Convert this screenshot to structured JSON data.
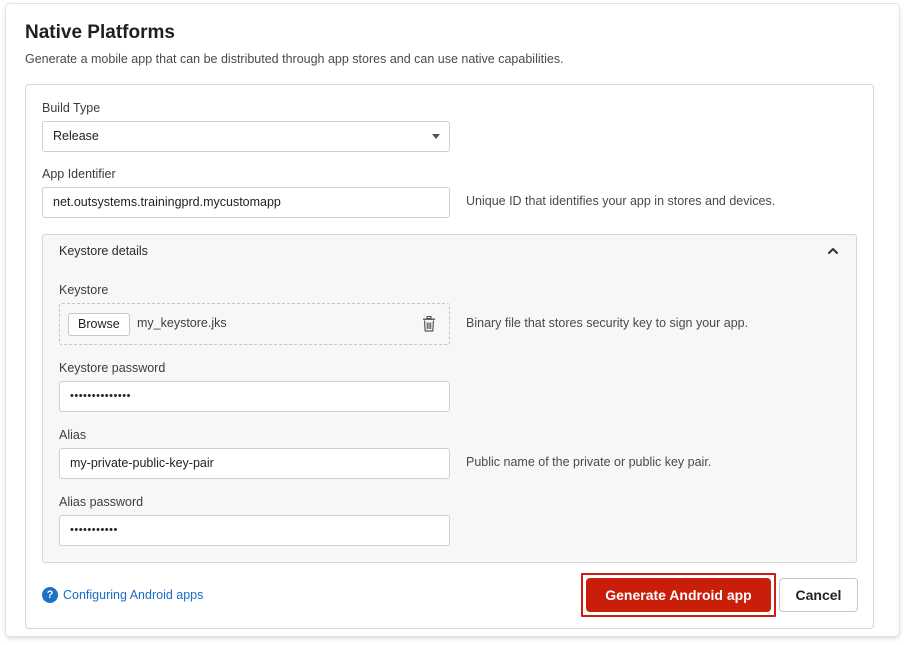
{
  "header": {
    "title": "Native Platforms",
    "subtitle": "Generate a mobile app that can be distributed through app stores and can use native capabilities."
  },
  "build_type": {
    "label": "Build Type",
    "value": "Release"
  },
  "app_identifier": {
    "label": "App Identifier",
    "value": "net.outsystems.trainingprd.mycustomapp",
    "hint": "Unique ID that identifies your app in stores and devices."
  },
  "keystore_details": {
    "title": "Keystore details",
    "keystore": {
      "label": "Keystore",
      "browse_label": "Browse",
      "file_name": "my_keystore.jks",
      "hint": "Binary file that stores security key to sign your app."
    },
    "keystore_password": {
      "label": "Keystore password",
      "value": "••••••••••••••"
    },
    "alias": {
      "label": "Alias",
      "value": "my-private-public-key-pair",
      "hint": "Public name of the private or public key pair."
    },
    "alias_password": {
      "label": "Alias password",
      "value": "•••••••••••"
    }
  },
  "footer": {
    "help_link": "Configuring Android apps",
    "primary_button": "Generate Android app",
    "secondary_button": "Cancel"
  },
  "icons": [
    "chevron-down-icon",
    "chevron-up-icon",
    "trash-icon",
    "help-icon"
  ],
  "colors": {
    "primary": "#c81e0a",
    "highlight_border": "#cc1c14",
    "link": "#1a6cc6"
  }
}
